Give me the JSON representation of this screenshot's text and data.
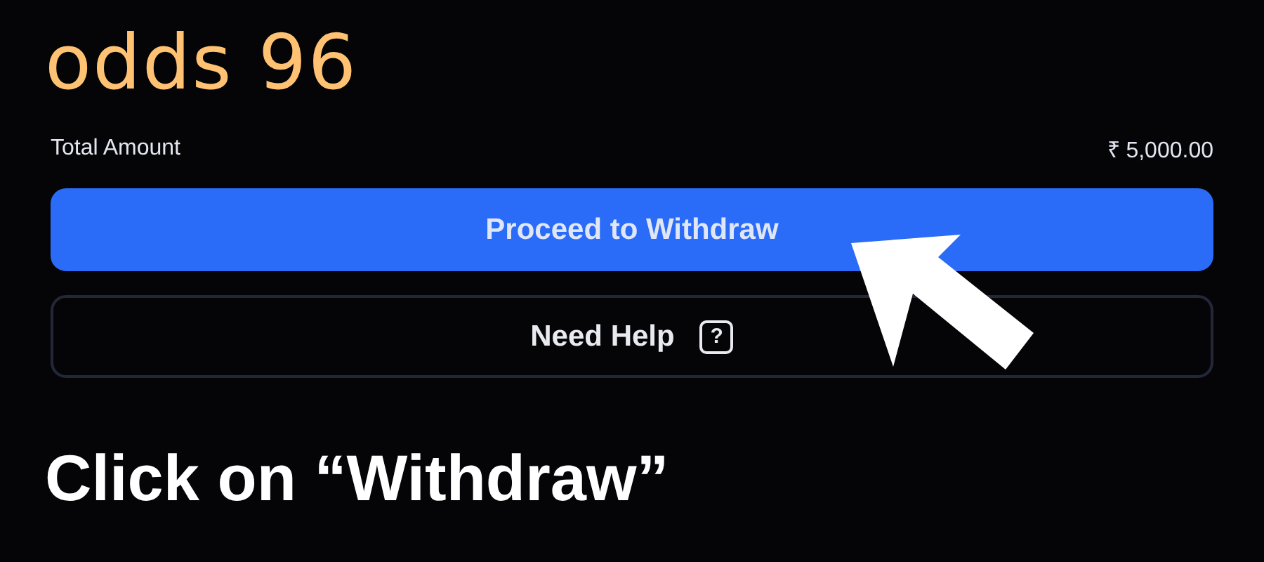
{
  "logo": "odds 96",
  "total": {
    "label": "Total Amount",
    "value": "₹ 5,000.00"
  },
  "buttons": [
    {
      "kind": "primary",
      "label": "Proceed to Withdraw"
    },
    {
      "kind": "outline",
      "label": "Need Help",
      "icon": "?"
    }
  ],
  "caption": "Click on “Withdraw”"
}
